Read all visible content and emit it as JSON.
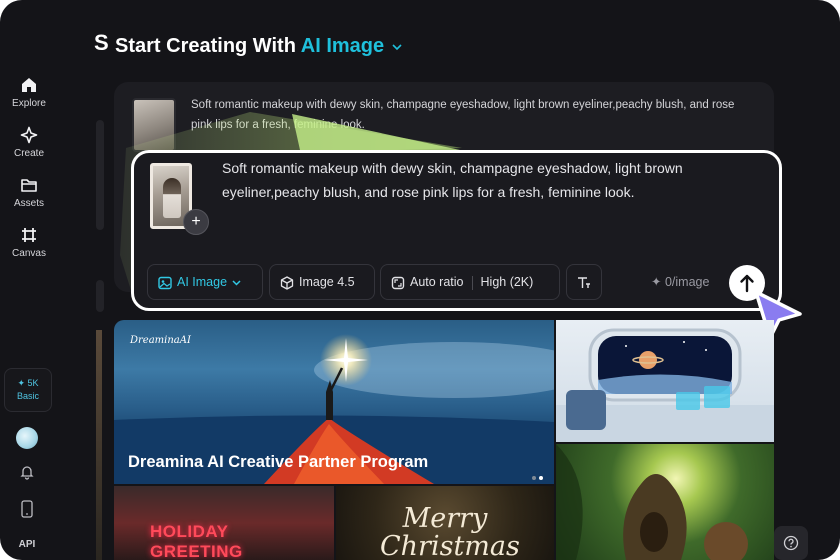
{
  "sidebar": {
    "items": [
      {
        "label": "Explore",
        "icon": "home-icon"
      },
      {
        "label": "Create",
        "icon": "sparkle-icon"
      },
      {
        "label": "Assets",
        "icon": "folder-icon"
      },
      {
        "label": "Canvas",
        "icon": "canvas-grid-icon"
      }
    ],
    "credits": {
      "amount": "✦ 5K",
      "tier": "Basic"
    },
    "api_label": "API"
  },
  "header": {
    "title_prefix": "Start Creating With",
    "title_accent": "AI Image",
    "clipped_letter": "S"
  },
  "background_prompt": {
    "text": "Soft romantic makeup with dewy skin, champagne eyeshadow, light brown eyeliner,peachy blush, and rose pink lips for a fresh, feminine look."
  },
  "prompt_card": {
    "text": "Soft romantic makeup with dewy skin, champagne eyeshadow, light brown eyeliner,peachy blush, and rose pink lips for a fresh, feminine look.",
    "add_reference": "+",
    "toolbar": {
      "model": "AI Image",
      "version": "Image 4.5",
      "ratio": "Auto ratio",
      "quality": "High (2K)",
      "cost": "0/image"
    }
  },
  "gallery": {
    "brand": "DreaminaAI",
    "banner_title": "Dreamina AI Creative Partner Program",
    "holiday_text": "HOLIDAY GREETING",
    "merry_text": "Merry Christmas"
  },
  "colors": {
    "accent": "#1fc0dc",
    "background": "#141418",
    "card": "#1a1a1f",
    "cursor": "#8a7cf0"
  }
}
